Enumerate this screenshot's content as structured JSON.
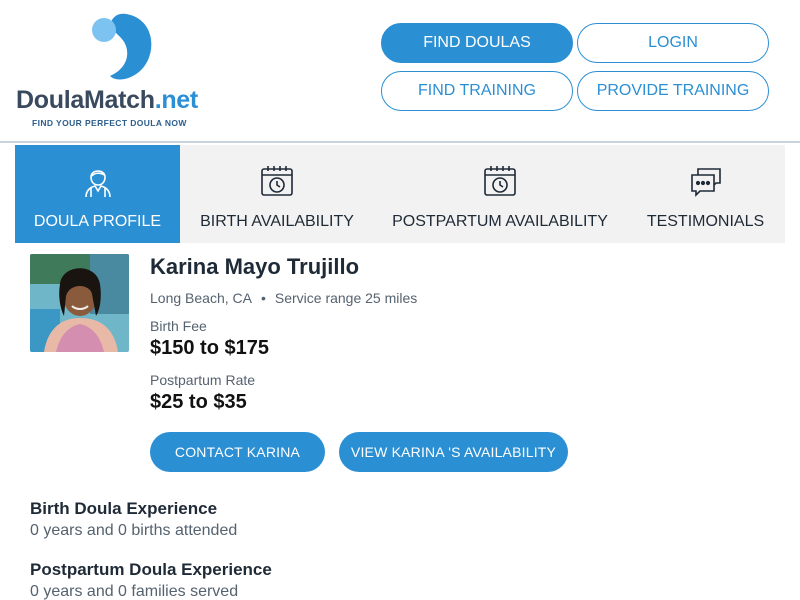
{
  "brand": {
    "logo_main": "Doula",
    "logo_main2": "Match",
    "logo_net": ".net",
    "tagline": "FIND YOUR PERFECT DOULA NOW",
    "colors": {
      "primary": "#2b8fd4",
      "text": "#1f2a37",
      "muted": "#55626f",
      "tab_bg": "#f2f2f2"
    }
  },
  "nav": {
    "find_doulas": "FIND DOULAS",
    "login": "LOGIN",
    "find_training": "FIND TRAINING",
    "provide_training": "PROVIDE TRAINING"
  },
  "tabs": [
    {
      "label": "DOULA PROFILE",
      "icon": "doula-person-icon",
      "active": true
    },
    {
      "label": "BIRTH AVAILABILITY",
      "icon": "calendar-clock-icon",
      "active": false
    },
    {
      "label": "POSTPARTUM AVAILABILITY",
      "icon": "calendar-clock-icon",
      "active": false
    },
    {
      "label": "TESTIMONIALS",
      "icon": "chat-bubbles-icon",
      "active": false
    }
  ],
  "profile": {
    "name": "Karina Mayo Trujillo",
    "location": "Long Beach, CA",
    "separator": "•",
    "service_range": "Service range 25 miles",
    "birth_fee_label": "Birth Fee",
    "birth_fee": "$150 to $175",
    "postpartum_rate_label": "Postpartum Rate",
    "postpartum_rate": "$25 to $35",
    "contact_button": "CONTACT KARINA",
    "availability_button": "VIEW KARINA 'S AVAILABILITY"
  },
  "experience": {
    "birth_title": "Birth Doula Experience",
    "birth_value": "0 years and 0 births attended",
    "postpartum_title": "Postpartum Doula Experience",
    "postpartum_value": "0 years and 0 families served"
  }
}
